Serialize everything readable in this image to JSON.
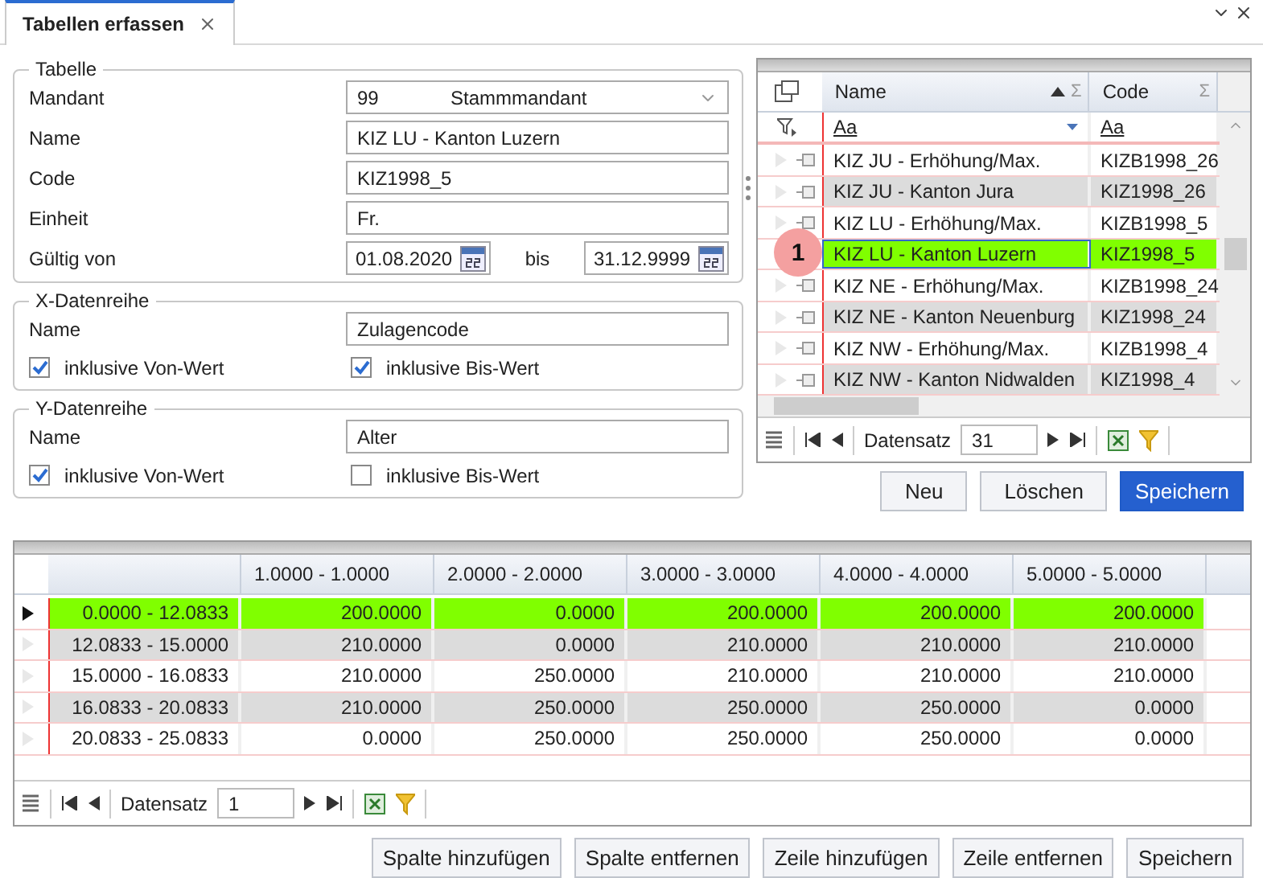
{
  "tabs": [
    {
      "label": "Tabellen erfassen",
      "selected": true
    }
  ],
  "tabelle": {
    "title": "Tabelle",
    "mandant": {
      "label": "Mandant",
      "number": "99",
      "name": "Stammmandant"
    },
    "fields": [
      {
        "label": "Name",
        "value": "KIZ LU - Kanton Luzern"
      },
      {
        "label": "Code",
        "value": "KIZ1998_5"
      },
      {
        "label": "Einheit",
        "value": "Fr."
      }
    ],
    "validity": {
      "label": "Gültig von",
      "from": "01.08.2020",
      "to_label": "bis",
      "to": "31.12.9999"
    }
  },
  "series": [
    {
      "title": "X-Datenreihe",
      "name_label": "Name",
      "name": "Zulagencode",
      "options": [
        {
          "label": "inklusive Von-Wert",
          "checked": true
        },
        {
          "label": "inklusive Bis-Wert",
          "checked": true
        }
      ]
    },
    {
      "title": "Y-Datenreihe",
      "name_label": "Name",
      "name": "Alter",
      "options": [
        {
          "label": "inklusive Von-Wert",
          "checked": true
        },
        {
          "label": "inklusive Bis-Wert",
          "checked": false
        }
      ]
    }
  ],
  "lookup_grid": {
    "columns": [
      {
        "label": "Name",
        "sum": "Σ",
        "sorted": true
      },
      {
        "label": "Code",
        "sum": "Σ",
        "sorted": false
      }
    ],
    "filters": [
      "Aa",
      "Aa"
    ],
    "rows": [
      {
        "name": "KIZ JU - Erhöhung/Max.",
        "code": "KIZB1998_26",
        "selected": false
      },
      {
        "name": "KIZ JU - Kanton Jura",
        "code": "KIZ1998_26",
        "selected": false
      },
      {
        "name": "KIZ LU - Erhöhung/Max.",
        "code": "KIZB1998_5",
        "selected": false
      },
      {
        "name": "KIZ LU - Kanton Luzern",
        "code": "KIZ1998_5",
        "selected": true
      },
      {
        "name": "KIZ NE - Erhöhung/Max.",
        "code": "KIZB1998_24",
        "selected": false
      },
      {
        "name": "KIZ NE - Kanton Neuenburg",
        "code": "KIZ1998_24",
        "selected": false
      },
      {
        "name": "KIZ NW - Erhöhung/Max.",
        "code": "KIZB1998_4",
        "selected": false
      },
      {
        "name": "KIZ NW - Kanton Nidwalden",
        "code": "KIZ1998_4",
        "selected": false
      }
    ],
    "badge": "1",
    "record_label": "Datensatz",
    "record": "31"
  },
  "lookup_buttons": [
    {
      "label": "Neu",
      "primary": false
    },
    {
      "label": "Löschen",
      "primary": false
    },
    {
      "label": "Speichern",
      "primary": true
    }
  ],
  "matrix": {
    "columns": [
      "1.0000 - 1.0000",
      "2.0000 - 2.0000",
      "3.0000 - 3.0000",
      "4.0000 - 4.0000",
      "5.0000 - 5.0000"
    ],
    "rows": [
      {
        "label": "0.0000 - 12.0833",
        "values": [
          "200.0000",
          "0.0000",
          "200.0000",
          "200.0000",
          "200.0000"
        ],
        "selected": true
      },
      {
        "label": "12.0833 - 15.0000",
        "values": [
          "210.0000",
          "0.0000",
          "210.0000",
          "210.0000",
          "210.0000"
        ],
        "selected": false
      },
      {
        "label": "15.0000 - 16.0833",
        "values": [
          "210.0000",
          "250.0000",
          "210.0000",
          "210.0000",
          "210.0000"
        ],
        "selected": false
      },
      {
        "label": "16.0833 - 20.0833",
        "values": [
          "210.0000",
          "250.0000",
          "250.0000",
          "250.0000",
          "0.0000"
        ],
        "selected": false
      },
      {
        "label": "20.0833 - 25.0833",
        "values": [
          "0.0000",
          "250.0000",
          "250.0000",
          "250.0000",
          "0.0000"
        ],
        "selected": false
      }
    ],
    "record_label": "Datensatz",
    "record": "1"
  },
  "matrix_buttons": [
    {
      "label": "Spalte hinzufügen",
      "primary": false
    },
    {
      "label": "Spalte entfernen",
      "primary": false
    },
    {
      "label": "Zeile hinzufügen",
      "primary": false
    },
    {
      "label": "Zeile entfernen",
      "primary": false
    },
    {
      "label": "Speichern",
      "primary": false
    }
  ]
}
